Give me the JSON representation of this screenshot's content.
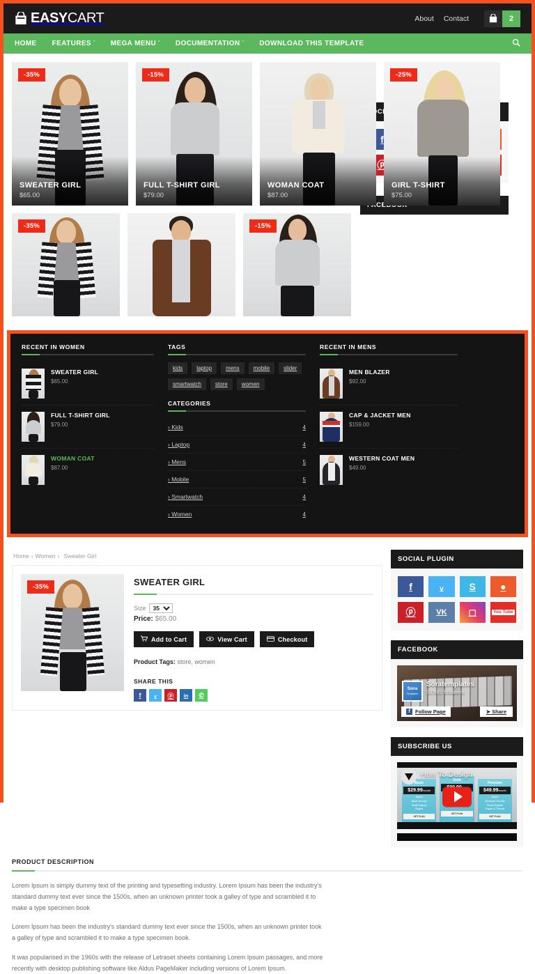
{
  "header": {
    "brand_text_bold": "EASY",
    "brand_text_light": "CART",
    "brand_icon": "shopping-bag-icon",
    "links": [
      {
        "label": "About"
      },
      {
        "label": "Contact"
      }
    ],
    "cart_icon": "shopping-bag-icon",
    "cart_count": "2"
  },
  "nav": {
    "items": [
      {
        "label": "HOME",
        "caret": ""
      },
      {
        "label": "FEATURES",
        "caret": "ˇ"
      },
      {
        "label": "MEGA MENU",
        "caret": "ˇ"
      },
      {
        "label": "DOCUMENTATION",
        "caret": "ˇ"
      },
      {
        "label": "DOWNLOAD THIS TEMPLATE",
        "caret": ""
      }
    ],
    "search_icon": "search-icon"
  },
  "grid": {
    "row1": [
      {
        "badge": "-35%",
        "title": "SWEATER GIRL",
        "price": "$65.00"
      },
      {
        "badge": "-15%",
        "title": "FULL T-SHIRT GIRL",
        "price": "$79.00"
      },
      {
        "badge": "",
        "title": "WOMAN COAT",
        "price": "$87.00"
      },
      {
        "badge": "-25%",
        "title": "GIRL T-SHIRT",
        "price": "$75.00"
      }
    ],
    "row2": [
      {
        "badge": "-35%",
        "title": "",
        "price": ""
      },
      {
        "badge": "",
        "title": "",
        "price": ""
      },
      {
        "badge": "-15%",
        "title": "",
        "price": ""
      }
    ]
  },
  "social_widget": {
    "title": "SOCIAL PLUGIN",
    "tiles": [
      {
        "name": "facebook-icon",
        "glyph": "f",
        "cls": "s-fb"
      },
      {
        "name": "twitter-icon",
        "glyph": "ᵥ",
        "cls": "s-tw"
      },
      {
        "name": "skype-icon",
        "glyph": "S",
        "cls": "s-sk"
      },
      {
        "name": "reddit-icon",
        "glyph": "●",
        "cls": "s-rd"
      },
      {
        "name": "pinterest-icon",
        "glyph": "ⓟ",
        "cls": "s-pi"
      },
      {
        "name": "vk-icon",
        "glyph": "VK",
        "cls": "s-vk"
      },
      {
        "name": "instagram-icon",
        "glyph": "▢",
        "cls": "s-ig"
      },
      {
        "name": "youtube-icon",
        "glyph": "You Tube",
        "cls": "s-yt"
      }
    ]
  },
  "facebook_widget": {
    "title": "FACEBOOK",
    "page_name": "Soratemplates",
    "followers": "53,682 followers",
    "avatar_title": "Sora",
    "avatar_sub": "Templates",
    "follow_label": "Follow Page",
    "follow_icon": "facebook-icon",
    "share_label": "Share",
    "share_icon": "share-icon"
  },
  "footer": {
    "recent_women": {
      "title": "RECENT IN WOMEN",
      "items": [
        {
          "name": "SWEATER GIRL",
          "price": "$65.00",
          "active": false
        },
        {
          "name": "FULL T-SHIRT GIRL",
          "price": "$79.00",
          "active": false
        },
        {
          "name": "WOMAN COAT",
          "price": "$87.00",
          "active": true
        }
      ]
    },
    "tags": {
      "title": "TAGS",
      "items": [
        "kids",
        "laptop",
        "mens",
        "mobile",
        "slider",
        "smartwatch",
        "store",
        "women"
      ]
    },
    "categories": {
      "title": "CATEGORIES",
      "items": [
        {
          "label": "Kids",
          "count": "4"
        },
        {
          "label": "Laptop",
          "count": "4"
        },
        {
          "label": "Mens",
          "count": "5"
        },
        {
          "label": "Mobile",
          "count": "5"
        },
        {
          "label": "Smartwatch",
          "count": "4"
        },
        {
          "label": "Women",
          "count": "4"
        }
      ]
    },
    "recent_mens": {
      "title": "RECENT IN MENS",
      "items": [
        {
          "name": "MEN BLAZER",
          "price": "$92.00"
        },
        {
          "name": "CAP & JACKET MEN",
          "price": "$159.00"
        },
        {
          "name": "WESTERN COAT MEN",
          "price": "$49.00"
        }
      ]
    }
  },
  "detail": {
    "breadcrumb": [
      "Home",
      "Women",
      "Sweater Girl"
    ],
    "breadcrumb_sep": "›",
    "badge": "-35%",
    "title": "SWEATER GIRL",
    "size_label": "Size",
    "size_value": "35",
    "size_options": [
      "35"
    ],
    "price_label": "Price:",
    "price_value": "$65.00",
    "buttons": [
      {
        "label": "Add to Cart",
        "icon": "cart-icon",
        "glyph": "Ὥ2"
      },
      {
        "label": "View Cart",
        "icon": "eye-icon",
        "glyph": "◉"
      },
      {
        "label": "Checkout",
        "icon": "credit-card-icon",
        "glyph": "▤"
      }
    ],
    "tags_label": "Product Tags:",
    "tags_value": "store, women",
    "share_title": "SHARE THIS",
    "share": [
      {
        "name": "facebook-share-icon",
        "glyph": "f",
        "cls": "sh-fb"
      },
      {
        "name": "twitter-share-icon",
        "glyph": "ᵥ",
        "cls": "sh-tw"
      },
      {
        "name": "pinterest-share-icon",
        "glyph": "ⓟ",
        "cls": "sh-pi"
      },
      {
        "name": "linkedin-share-icon",
        "glyph": "in",
        "cls": "sh-in"
      },
      {
        "name": "whatsapp-share-icon",
        "glyph": "✆",
        "cls": "sh-wa"
      }
    ]
  },
  "description": {
    "title": "PRODUCT DESCRIPTION",
    "paragraphs": [
      "Lorem Ipsum is simply dummy text of the printing and typesetting industry. Lorem Ipsum has been the industry's standard dummy text ever since the 1500s, when an unknown printer took a galley of type and scrambled it to make a type specimen book",
      "Lorem Ipsum has been the industry's standard dummy text ever since the 1500s, when an unknown printer took a galley of type and scrambled it to make a type specimen book.",
      "It was popularised in the 1960s with the release of Letraset sheets containing Lorem Ipsum passages, and more recently with desktop publishing software like Aldus PageMaker including versions of Lorem Ipsum."
    ]
  },
  "subscribe": {
    "title": "SUBSCRIBE US",
    "video_title": "How To Design",
    "play_icon": "play-button-icon",
    "menu_icon": "kebab-menu-icon",
    "plans": [
      {
        "name": "Basic",
        "price": "$29.99",
        "per": "/month",
        "features": "Speed\nBasic Security\nEmail Support\nPlugins",
        "button": "GET PLAN"
      },
      {
        "name": "Gold",
        "price": "$99.99",
        "per": "/year",
        "features": "Speed\nFull Security\nPhone Support\nPlugins",
        "button": "GET PLAN"
      },
      {
        "name": "Premium",
        "price": "$49.99",
        "per": "/month",
        "features": "Speed\nAdvanced Security\nPhone Support\nPlugins & Themes",
        "button": "GET PLAN"
      }
    ]
  },
  "colors": {
    "accent_green": "#5cb85c",
    "badge_red": "#ee2b18",
    "frame_orange": "#f4511e",
    "dark": "#141414"
  }
}
